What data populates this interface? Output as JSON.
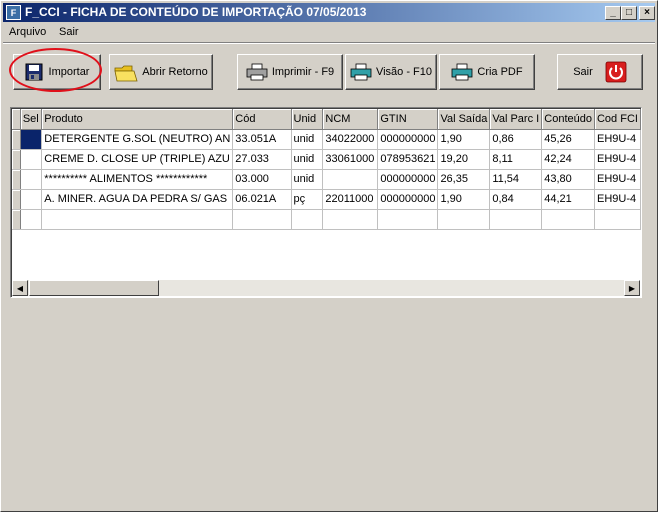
{
  "window": {
    "title": "F_CCI - FICHA DE CONTEÚDO DE IMPORTAÇÃO 07/05/2013",
    "minimize": "_",
    "maximize": "□",
    "close": "×"
  },
  "menu": [
    {
      "label": "Arquivo"
    },
    {
      "label": "Sair"
    }
  ],
  "toolbar": {
    "importar": "Importar",
    "abrir_retorno": "Abrir Retorno",
    "imprimir": "Imprimir - F9",
    "visao": "Visão - F10",
    "cria_pdf": "Cria PDF",
    "sair": "Sair"
  },
  "icons": {
    "importar": "floppy-disk-icon",
    "abrir_retorno": "folder-open-icon",
    "imprimir": "printer-icon",
    "visao": "print-preview-icon",
    "cria_pdf": "pdf-printer-icon",
    "sair": "power-icon"
  },
  "colors": {
    "title_start": "#0a246a",
    "title_end": "#a6caf0",
    "highlight": "#e0101a",
    "exit_red": "#d81e1e"
  },
  "grid": {
    "columns": [
      "Sel",
      "Produto",
      "Cód",
      "Unid",
      "NCM",
      "GTIN",
      "Val Saída",
      "Val Parc I",
      "Conteúdo",
      "Cod FCI"
    ],
    "rows": [
      [
        "",
        "DETERGENTE G.SOL (NEUTRO) AN",
        "33.051A",
        "unid",
        "34022000",
        "000000000",
        "1,90",
        "0,86",
        "45,26",
        "EH9U-4"
      ],
      [
        "",
        "CREME D. CLOSE UP (TRIPLE) AZU",
        "27.033",
        "unid",
        "33061000",
        "078953621",
        "19,20",
        "8,11",
        "42,24",
        "EH9U-4"
      ],
      [
        "",
        "********** ALIMENTOS ************",
        "03.000",
        "unid",
        "",
        "000000000",
        "26,35",
        "11,54",
        "43,80",
        "EH9U-4"
      ],
      [
        "",
        "A. MINER. AGUA DA PEDRA S/ GAS",
        "06.021A",
        "pç",
        "22011000",
        "000000000",
        "1,90",
        "0,84",
        "44,21",
        "EH9U-4"
      ],
      [
        "",
        "",
        "",
        "",
        "",
        "",
        "",
        "",
        "",
        ""
      ]
    ]
  }
}
